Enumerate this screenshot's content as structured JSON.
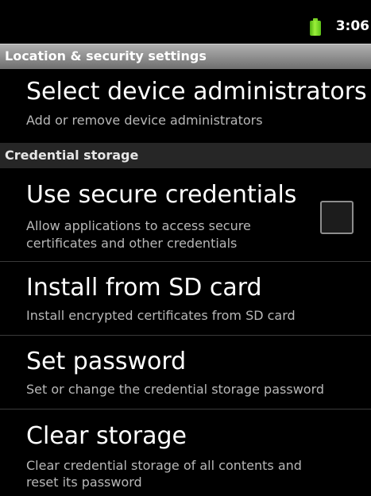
{
  "status_bar": {
    "time": "3:06",
    "battery_icon": "battery-full-icon",
    "battery_color": "#7bd427"
  },
  "title_bar": {
    "title": "Location & security settings"
  },
  "items": {
    "device_admins": {
      "title": "Select device administrators",
      "summary": "Add or remove device administrators"
    },
    "secure_credentials": {
      "title": "Use secure credentials",
      "summary_line1": "Allow applications to access secure",
      "summary_line2": "certificates and other credentials",
      "checked": false
    },
    "install_sd": {
      "title": "Install from SD card",
      "summary": "Install encrypted certificates from SD card"
    },
    "set_password": {
      "title": "Set password",
      "summary": "Set or change the credential storage password"
    },
    "clear_storage": {
      "title": "Clear storage",
      "summary_line1": "Clear credential storage of all contents and",
      "summary_line2": "reset its password"
    }
  },
  "categories": {
    "credential_storage": "Credential storage"
  }
}
